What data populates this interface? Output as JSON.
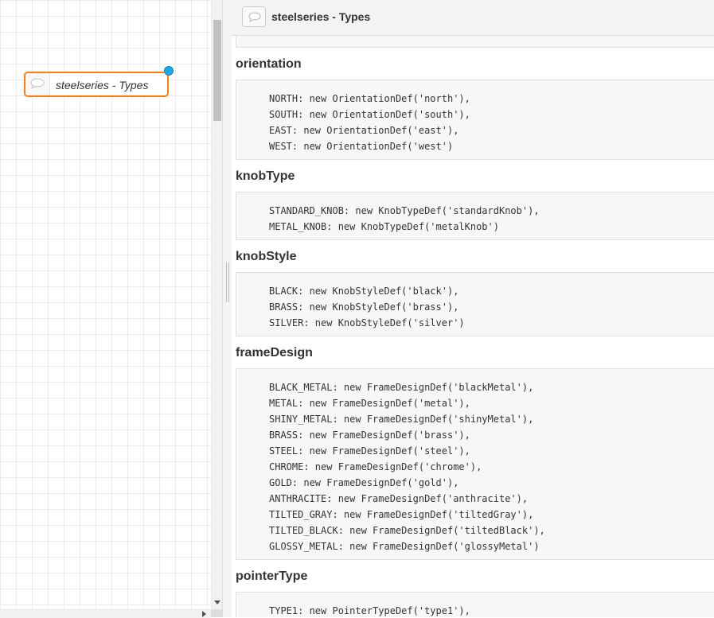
{
  "node": {
    "label": "steelseries - Types"
  },
  "panel": {
    "title": "steelseries - Types",
    "sections": [
      {
        "title": "orientation",
        "lines": [
          "NORTH: new OrientationDef('north'),",
          "SOUTH: new OrientationDef('south'),",
          "EAST: new OrientationDef('east'),",
          "WEST: new OrientationDef('west')"
        ]
      },
      {
        "title": "knobType",
        "lines": [
          "STANDARD_KNOB: new KnobTypeDef('standardKnob'),",
          "METAL_KNOB: new KnobTypeDef('metalKnob')"
        ]
      },
      {
        "title": "knobStyle",
        "lines": [
          "BLACK: new KnobStyleDef('black'),",
          "BRASS: new KnobStyleDef('brass'),",
          "SILVER: new KnobStyleDef('silver')"
        ]
      },
      {
        "title": "frameDesign",
        "lines": [
          "BLACK_METAL: new FrameDesignDef('blackMetal'),",
          "METAL: new FrameDesignDef('metal'),",
          "SHINY_METAL: new FrameDesignDef('shinyMetal'),",
          "BRASS: new FrameDesignDef('brass'),",
          "STEEL: new FrameDesignDef('steel'),",
          "CHROME: new FrameDesignDef('chrome'),",
          "GOLD: new FrameDesignDef('gold'),",
          "ANTHRACITE: new FrameDesignDef('anthracite'),",
          "TILTED_GRAY: new FrameDesignDef('tiltedGray'),",
          "TILTED_BLACK: new FrameDesignDef('tiltedBlack'),",
          "GLOSSY_METAL: new FrameDesignDef('glossyMetal')"
        ]
      },
      {
        "title": "pointerType",
        "lines": [
          "TYPE1: new PointerTypeDef('type1'),"
        ]
      }
    ]
  },
  "icons": {
    "node": "comment-icon",
    "header": "comment-icon"
  },
  "colors": {
    "node_border": "#ff7f0e",
    "port": "#1fa7e6"
  }
}
